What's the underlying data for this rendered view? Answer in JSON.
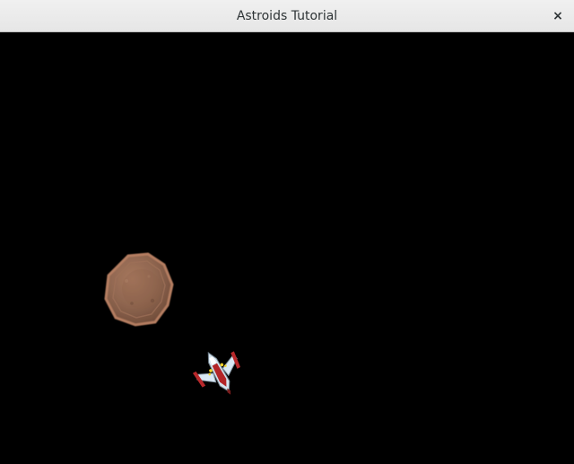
{
  "window": {
    "title": "Astroids Tutorial",
    "close_glyph": "×"
  },
  "scene": {
    "background_color": "#000000",
    "objects": [
      {
        "type": "asteroid",
        "color": "#9a6a52"
      },
      {
        "type": "ship",
        "colors": [
          "#d8e7f3",
          "#b5292b",
          "#f1d22d"
        ]
      }
    ]
  }
}
